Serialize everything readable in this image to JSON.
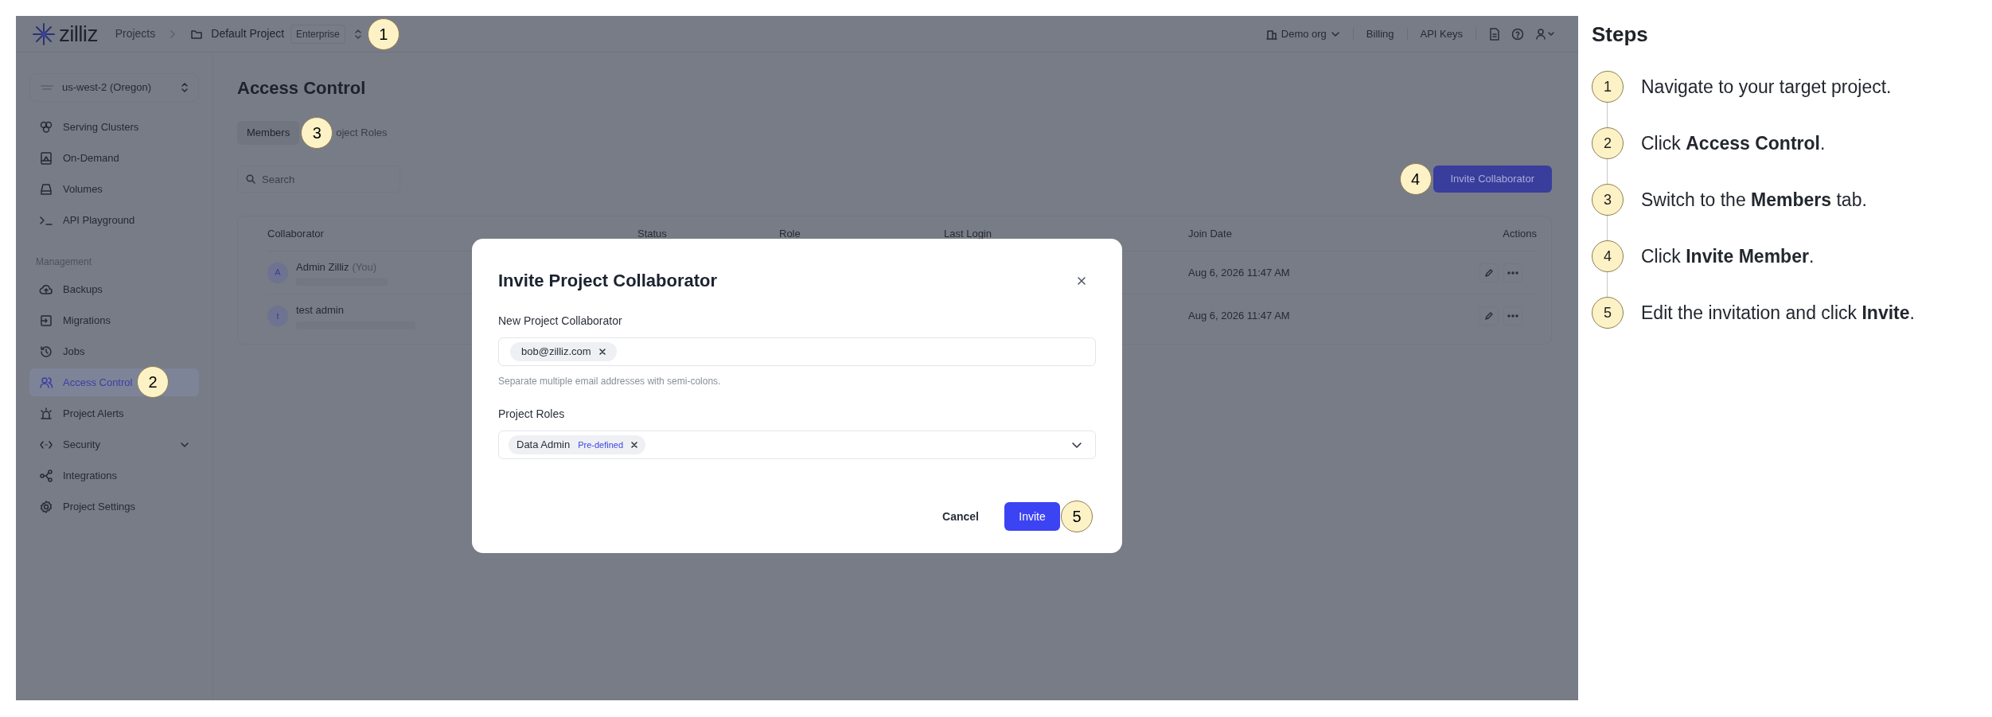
{
  "app": {
    "topbar": {
      "logo": "zilliz",
      "breadcrumb": [
        {
          "label": "Projects"
        },
        {
          "label": "Default Project",
          "tag": "Enterprise",
          "marker": "1"
        }
      ],
      "org": "Demo org",
      "links": [
        "Billing",
        "API Keys"
      ]
    },
    "sidebar": {
      "region": "us-west-2 (Oregon)",
      "sections": [
        {
          "items": [
            {
              "label": "Serving Clusters",
              "kind": "link",
              "selected": false
            },
            {
              "label": "On-Demand",
              "kind": "link",
              "selected": false
            },
            {
              "label": "Volumes",
              "kind": "link",
              "selected": false
            },
            {
              "label": "API Playground",
              "kind": "link",
              "selected": false
            }
          ]
        },
        {
          "heading": "Management",
          "items": [
            {
              "label": "Backups",
              "kind": "link",
              "selected": false
            },
            {
              "label": "Migrations",
              "kind": "link",
              "selected": false
            },
            {
              "label": "Jobs",
              "kind": "link",
              "selected": false
            },
            {
              "label": "Access Control",
              "kind": "link",
              "selected": true,
              "marker": "2"
            },
            {
              "label": "Project Alerts",
              "kind": "link",
              "selected": false
            },
            {
              "label": "Security",
              "kind": "group",
              "selected": false
            },
            {
              "label": "Integrations",
              "kind": "link",
              "selected": false
            },
            {
              "label": "Project Settings",
              "kind": "link",
              "selected": false
            }
          ]
        }
      ]
    },
    "main": {
      "title": "Access Control",
      "tabs": [
        {
          "label": "Members",
          "selected": true,
          "marker": "3"
        },
        {
          "label": "oject Roles",
          "selected": false
        }
      ],
      "search": {
        "placeholder": "Search"
      },
      "invite_button": {
        "label": "Invite Collaborator",
        "marker": "4"
      },
      "table": {
        "columns": [
          "Collaborator",
          "Status",
          "Role",
          "Last Login",
          "Join Date",
          "Actions"
        ],
        "rows": [
          {
            "avatar": "A",
            "name": "Admin Zilliz",
            "suffix": "(You)",
            "join_date": "Aug 6, 2026 11:47 AM"
          },
          {
            "avatar": "t",
            "name": "test admin",
            "join_date": "Aug 6, 2026 11:47 AM"
          }
        ]
      }
    },
    "modal": {
      "title": "Invite Project Collaborator",
      "collaborator_label": "New Project Collaborator",
      "emails": [
        {
          "label": "bob@zilliz.com"
        }
      ],
      "hint": "Separate multiple email addresses with semi-colons.",
      "roles_label": "Project Roles",
      "roles": [
        {
          "label": "Data Admin",
          "tag": "Pre-defined"
        }
      ],
      "cancel": "Cancel",
      "invite": {
        "label": "Invite",
        "marker": "5"
      }
    }
  },
  "steps": {
    "title": "Steps",
    "items": [
      {
        "number": "1",
        "text": "Navigate to your target project."
      },
      {
        "number": "2",
        "text": "Click **Access Control**."
      },
      {
        "number": "3",
        "text": "Switch to the **Members** tab."
      },
      {
        "number": "4",
        "text": "Click **Invite Member**."
      },
      {
        "number": "5",
        "text": "Edit the invitation and click **Invite**."
      }
    ]
  }
}
